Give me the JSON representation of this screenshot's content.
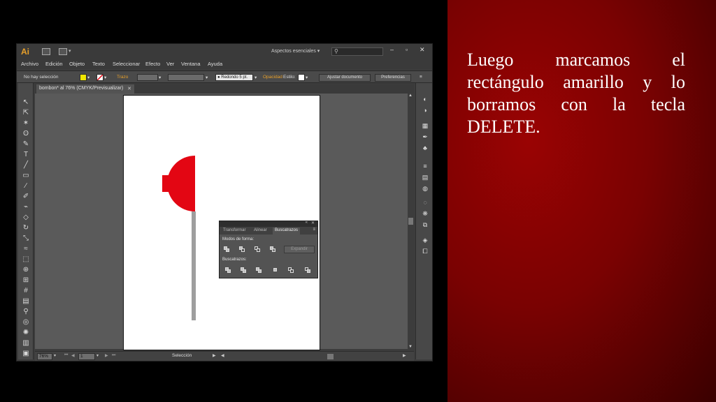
{
  "slide": {
    "text": "Luego marcamos el rectángulo amarillo y lo borramos con la tecla DELETE."
  },
  "app": {
    "logo": "Ai",
    "workspace": "Aspectos esenciales",
    "menu": [
      "Archivo",
      "Edición",
      "Objeto",
      "Texto",
      "Seleccionar",
      "Efecto",
      "Ver",
      "Ventana",
      "Ayuda"
    ],
    "control_bar": {
      "selection": "No hay selección",
      "stroke_label": "Trazo",
      "brush": "Redondo 5 pt.",
      "opacity_label": "Opacidad",
      "style_label": "Estilo:",
      "doc_setup_button": "Ajustar documento",
      "prefs_button": "Preferencias",
      "fill_color": "#f0e600",
      "stroke_label_color": "#e8a02a"
    },
    "document_tab": "bombon* al 76% (CMYK/Previsualizar)",
    "status_bar": {
      "zoom": "76%",
      "page": "1",
      "tool": "Selección"
    },
    "pathfinder": {
      "tabs": [
        "Transformar",
        "Alinear",
        "Buscatrazos"
      ],
      "active_tab": "Buscatrazos",
      "shape_modes_label": "Modos de forma:",
      "expand_button": "Expandir",
      "pathfinders_label": "Buscatrazos:"
    },
    "artwork": {
      "candy_color": "#e30613",
      "stick_color": "#9e9e9e"
    }
  }
}
